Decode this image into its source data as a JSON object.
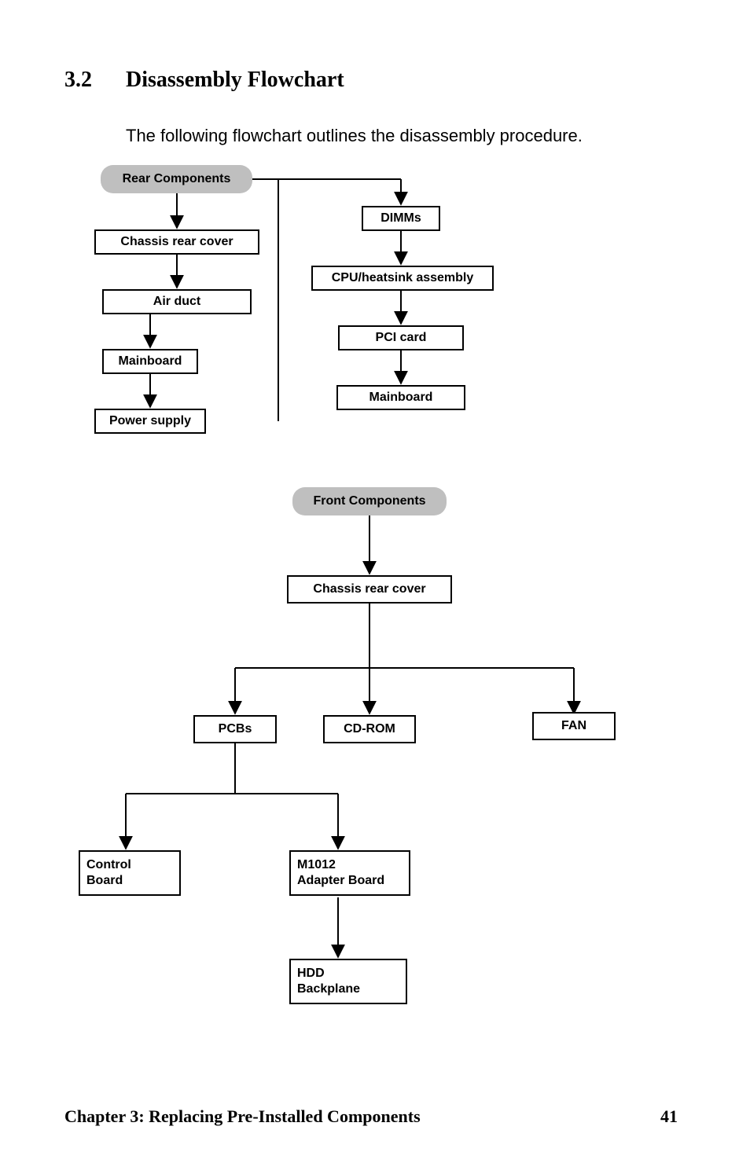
{
  "heading_number": "3.2",
  "heading_text": "Disassembly Flowchart",
  "intro_text": "The following flowchart outlines the disassembly procedure.",
  "footer_left": "Chapter 3: Replacing Pre-Installed Components",
  "footer_right": "41",
  "rear_components_label": "Rear Components",
  "front_components_label": "Front Components",
  "chassis_rear_cover_label": "Chassis rear cover",
  "air_duct_label": "Air duct",
  "mainboard_label": "Mainboard",
  "power_supply_label": "Power supply",
  "dimms_label": "DIMMs",
  "cpu_heatsink_label": "CPU/heatsink assembly",
  "pci_card_label": "PCI card",
  "mainboard2_label": "Mainboard",
  "chassis_rear_cover2_label": "Chassis rear cover",
  "pcbs_label": "PCBs",
  "cdrom_label": "CD-ROM",
  "fan_label": "FAN",
  "control_board_label": "Control\nBoard",
  "m1012_label": "M1012\nAdapter Board",
  "hdd_backplane_label": "HDD\nBackplane"
}
